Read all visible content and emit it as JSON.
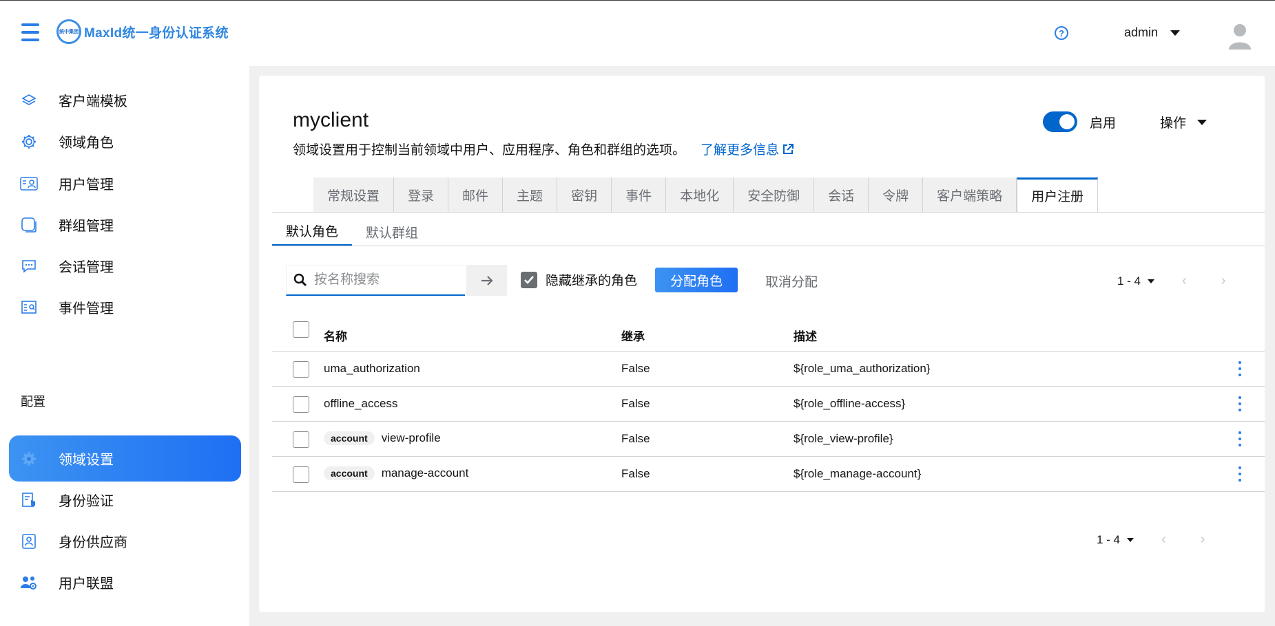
{
  "header": {
    "logo_mark_text": "统中集团",
    "app_title": "MaxId统一身份认证系统",
    "user_name": "admin"
  },
  "sidebar": {
    "items": [
      {
        "label": "客户端模板",
        "icon": "layers-icon"
      },
      {
        "label": "领域角色",
        "icon": "gear-icon"
      },
      {
        "label": "用户管理",
        "icon": "id-card-icon"
      },
      {
        "label": "群组管理",
        "icon": "window-stack-icon"
      },
      {
        "label": "会话管理",
        "icon": "chat-icon"
      },
      {
        "label": "事件管理",
        "icon": "event-log-icon"
      }
    ],
    "section_label": "配置",
    "config_items": [
      {
        "label": "领域设置",
        "icon": "gear-icon",
        "active": true
      },
      {
        "label": "身份验证",
        "icon": "shield-doc-icon"
      },
      {
        "label": "身份供应商",
        "icon": "id-badge-icon"
      },
      {
        "label": "用户联盟",
        "icon": "users-gear-icon"
      }
    ]
  },
  "page": {
    "title": "myclient",
    "description": "领域设置用于控制当前领域中用户、应用程序、角色和群组的选项。",
    "learn_more": "了解更多信息",
    "enabled_label": "启用",
    "enabled": true,
    "action_label": "操作"
  },
  "tabs": [
    "常规设置",
    "登录",
    "邮件",
    "主题",
    "密钥",
    "事件",
    "本地化",
    "安全防御",
    "会话",
    "令牌",
    "客户端策略",
    "用户注册"
  ],
  "active_tab": "用户注册",
  "subtabs": [
    "默认角色",
    "默认群组"
  ],
  "toolbar": {
    "search_placeholder": "按名称搜索",
    "hide_inherited_label": "隐藏继承的角色",
    "hide_inherited_checked": true,
    "assign_label": "分配角色",
    "unassign_label": "取消分配",
    "pagination": "1 - 4"
  },
  "table": {
    "headers": {
      "name": "名称",
      "inherited": "继承",
      "description": "描述"
    },
    "rows": [
      {
        "badge": "",
        "name": "uma_authorization",
        "inherited": "False",
        "description": "${role_uma_authorization}"
      },
      {
        "badge": "",
        "name": "offline_access",
        "inherited": "False",
        "description": "${role_offline-access}"
      },
      {
        "badge": "account",
        "name": "view-profile",
        "inherited": "False",
        "description": "${role_view-profile}"
      },
      {
        "badge": "account",
        "name": "manage-account",
        "inherited": "False",
        "description": "${role_manage-account}"
      }
    ]
  },
  "footer_pagination": "1 - 4",
  "colors": {
    "accent": "#0066cc",
    "brand_gradient_start": "#3d93f2",
    "brand_gradient_end": "#1f6ff3",
    "icon_blue": "#2b7de9"
  }
}
